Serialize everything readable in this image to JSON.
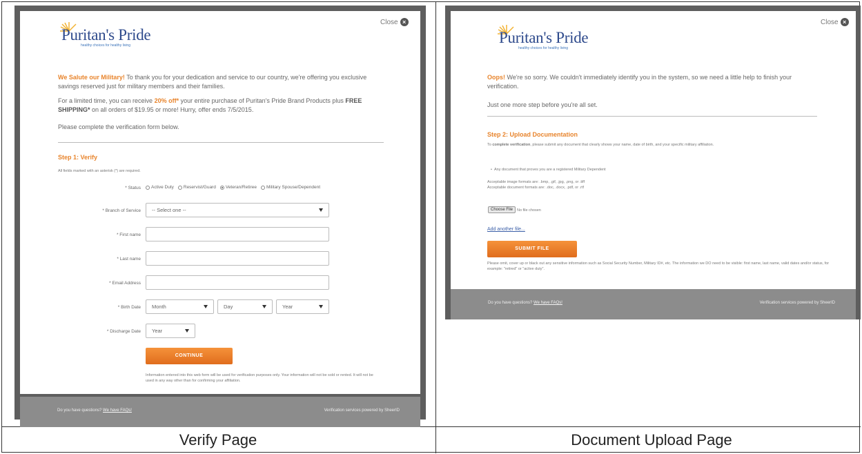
{
  "captions": {
    "left": "Verify Page",
    "right": "Document Upload Page"
  },
  "brand": {
    "name": "Puritan's Pride",
    "tagline": "healthy choices for healthy living",
    "accent_color": "#e8842c",
    "logo_color": "#2e4a8c"
  },
  "close_label": "Close",
  "verify": {
    "intro_lead": "We Salute our Military!",
    "intro_rest": " To thank you for your dedication and service to our country, we're offering you exclusive savings reserved just for military members and their families.",
    "offer_pre": "For a limited time, you can receive ",
    "offer_discount": "20% off*",
    "offer_mid": " your entire purchase of Puritan's Pride Brand Products plus ",
    "offer_shipping": "FREE SHIPPING*",
    "offer_post": " on all orders of $19.95 or more! Hurry, offer ends 7/5/2015.",
    "instruction": "Please complete the verification form below.",
    "step_title": "Step 1: Verify",
    "required_note": "All fields marked with an asterisk (*) are required.",
    "status_label": "* Status",
    "status_options": [
      "Active Duty",
      "Reservist/Guard",
      "Veteran/Retiree",
      "Military Spouse/Dependent"
    ],
    "status_selected": 2,
    "branch_label": "* Branch of Service",
    "branch_placeholder": "-- Select one --",
    "first_label": "* First name",
    "last_label": "* Last name",
    "email_label": "* Email Address",
    "birth_label": "* Birth Date",
    "birth_month": "Month",
    "birth_day": "Day",
    "birth_year": "Year",
    "discharge_label": "* Discharge Date",
    "discharge_year": "Year",
    "continue_label": "CONTINUE",
    "disclaimer": "Information entered into this web form will be used for verification purposes only. Your information will not be sold or rented. It will not be used in any way other than for confirming your affiliation.",
    "footer_question": "Do you have questions? ",
    "footer_link": "We have FAQs!",
    "footer_powered": "Verification services powered by SheerID"
  },
  "upload": {
    "oops_lead": "Oops!",
    "oops_rest": " We're so sorry. We couldn't immediately identify you in the system, so we need a little help to finish your verification.",
    "one_more": "Just one more step before you're all set.",
    "step_title": "Step 2: Upload Documentation",
    "complete_pre": "To ",
    "complete_bold": "complete verification",
    "complete_rest": ", please submit any document that clearly shows your name, date of birth, and your specific military affiliation.",
    "bullet": "Any document that proves you are a registered Military Dependent",
    "image_formats": "Acceptable image formats are: .bmp, .gif, .jpg, .png, or .tiff",
    "doc_formats": "Acceptable document formats are: .doc, .docx, .pdf, or .rtf",
    "choose_file": "Choose File",
    "no_file": "No file chosen",
    "add_another": "Add another file...",
    "submit_label": "SUBMIT FILE",
    "privacy": "Please omit, cover up or black out any sensitive information such as Social Security Number, Military ID#, etc. The information we DO need to be visible: first name, last name, valid dates and/or status, for example: \"retired\" or \"active duty\".",
    "footer_question": "Do you have questions? ",
    "footer_link": "We have FAQs!",
    "footer_powered": "Verification services powered by SheerID"
  }
}
